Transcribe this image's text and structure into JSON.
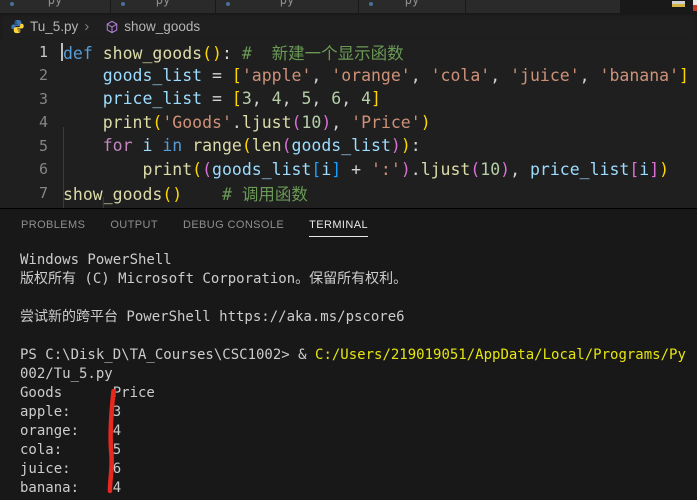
{
  "colors": {
    "editor_bg": "#1f1f1f",
    "panel_bg": "#181818",
    "tabstrip_bg": "#191919",
    "keyword_blue": "#569cd6",
    "keyword_purple": "#c586c0",
    "function_yellow": "#dcdcaa",
    "variable_blue": "#9cdcfe",
    "string_orange": "#ce9178",
    "number_green": "#b5cea8",
    "comment_green": "#6a9955",
    "bracket_gold": "#ffd700",
    "bracket_pink": "#da70d6",
    "bracket_blue": "#179fff",
    "terminal_fg": "#cccccc",
    "terminal_yellow": "#e5e510",
    "annotation_red": "#e8281e",
    "active_panel_tab": "#e7e7e7"
  },
  "top_tabs": [
    {
      "partial_label": "py"
    },
    {
      "partial_label": "py"
    },
    {
      "partial_label": "py"
    },
    {
      "partial_label": "py"
    },
    {
      "partial_label": ""
    }
  ],
  "breadcrumb": {
    "file": "Tu_5.py",
    "separator": "›",
    "symbol": "show_goods"
  },
  "editor": {
    "lines": [
      {
        "num": "1",
        "cursor": true,
        "tokens": [
          {
            "t": "def",
            "c": "kw"
          },
          {
            "t": " ",
            "c": "fg"
          },
          {
            "t": "show_goods",
            "c": "fn"
          },
          {
            "t": "(",
            "c": "b1"
          },
          {
            "t": ")",
            "c": "b1"
          },
          {
            "t": ":",
            "c": "fg"
          },
          {
            "t": " ",
            "c": "fg"
          },
          {
            "t": "#  新建一个显示函数",
            "c": "cm"
          }
        ]
      },
      {
        "num": "2",
        "tokens": [
          {
            "t": "    ",
            "c": "fg"
          },
          {
            "t": "goods_list",
            "c": "var"
          },
          {
            "t": " = ",
            "c": "fg"
          },
          {
            "t": "[",
            "c": "b1"
          },
          {
            "t": "'apple'",
            "c": "str"
          },
          {
            "t": ", ",
            "c": "fg"
          },
          {
            "t": "'orange'",
            "c": "str"
          },
          {
            "t": ", ",
            "c": "fg"
          },
          {
            "t": "'cola'",
            "c": "str"
          },
          {
            "t": ", ",
            "c": "fg"
          },
          {
            "t": "'juice'",
            "c": "str"
          },
          {
            "t": ", ",
            "c": "fg"
          },
          {
            "t": "'banana'",
            "c": "str"
          },
          {
            "t": "]",
            "c": "b1"
          }
        ]
      },
      {
        "num": "3",
        "tokens": [
          {
            "t": "    ",
            "c": "fg"
          },
          {
            "t": "price_list",
            "c": "var"
          },
          {
            "t": " = ",
            "c": "fg"
          },
          {
            "t": "[",
            "c": "b1"
          },
          {
            "t": "3",
            "c": "num"
          },
          {
            "t": ", ",
            "c": "fg"
          },
          {
            "t": "4",
            "c": "num"
          },
          {
            "t": ", ",
            "c": "fg"
          },
          {
            "t": "5",
            "c": "num"
          },
          {
            "t": ", ",
            "c": "fg"
          },
          {
            "t": "6",
            "c": "num"
          },
          {
            "t": ", ",
            "c": "fg"
          },
          {
            "t": "4",
            "c": "num"
          },
          {
            "t": "]",
            "c": "b1"
          }
        ]
      },
      {
        "num": "4",
        "tokens": [
          {
            "t": "    ",
            "c": "fg"
          },
          {
            "t": "print",
            "c": "fn"
          },
          {
            "t": "(",
            "c": "b1"
          },
          {
            "t": "'Goods'",
            "c": "str"
          },
          {
            "t": ".",
            "c": "fg"
          },
          {
            "t": "ljust",
            "c": "fn"
          },
          {
            "t": "(",
            "c": "b2"
          },
          {
            "t": "10",
            "c": "num"
          },
          {
            "t": ")",
            "c": "b2"
          },
          {
            "t": ", ",
            "c": "fg"
          },
          {
            "t": "'Price'",
            "c": "str"
          },
          {
            "t": ")",
            "c": "b1"
          }
        ]
      },
      {
        "num": "5",
        "tokens": [
          {
            "t": "    ",
            "c": "fg"
          },
          {
            "t": "for",
            "c": "kw2"
          },
          {
            "t": " ",
            "c": "fg"
          },
          {
            "t": "i",
            "c": "var"
          },
          {
            "t": " ",
            "c": "fg"
          },
          {
            "t": "in",
            "c": "kw"
          },
          {
            "t": " ",
            "c": "fg"
          },
          {
            "t": "range",
            "c": "fn"
          },
          {
            "t": "(",
            "c": "b1"
          },
          {
            "t": "len",
            "c": "fn"
          },
          {
            "t": "(",
            "c": "b2"
          },
          {
            "t": "goods_list",
            "c": "var"
          },
          {
            "t": ")",
            "c": "b2"
          },
          {
            "t": ")",
            "c": "b1"
          },
          {
            "t": ":",
            "c": "fg"
          }
        ]
      },
      {
        "num": "6",
        "tokens": [
          {
            "t": "        ",
            "c": "fg"
          },
          {
            "t": "print",
            "c": "fn"
          },
          {
            "t": "(",
            "c": "b1"
          },
          {
            "t": "(",
            "c": "b2"
          },
          {
            "t": "goods_list",
            "c": "var"
          },
          {
            "t": "[",
            "c": "b3"
          },
          {
            "t": "i",
            "c": "var"
          },
          {
            "t": "]",
            "c": "b3"
          },
          {
            "t": " + ",
            "c": "fg"
          },
          {
            "t": "':'",
            "c": "str"
          },
          {
            "t": ")",
            "c": "b2"
          },
          {
            "t": ".",
            "c": "fg"
          },
          {
            "t": "ljust",
            "c": "fn"
          },
          {
            "t": "(",
            "c": "b2"
          },
          {
            "t": "10",
            "c": "num"
          },
          {
            "t": ")",
            "c": "b2"
          },
          {
            "t": ", ",
            "c": "fg"
          },
          {
            "t": "price_list",
            "c": "var"
          },
          {
            "t": "[",
            "c": "b2"
          },
          {
            "t": "i",
            "c": "var"
          },
          {
            "t": "]",
            "c": "b2"
          },
          {
            "t": ")",
            "c": "b1"
          }
        ]
      },
      {
        "num": "7",
        "tokens": [
          {
            "t": "show_goods",
            "c": "fn"
          },
          {
            "t": "(",
            "c": "b1"
          },
          {
            "t": ")",
            "c": "b1"
          },
          {
            "t": "    ",
            "c": "fg"
          },
          {
            "t": "# 调用函数",
            "c": "cm"
          }
        ]
      }
    ]
  },
  "panel": {
    "tabs": [
      {
        "label": "PROBLEMS",
        "active": false
      },
      {
        "label": "OUTPUT",
        "active": false
      },
      {
        "label": "DEBUG CONSOLE",
        "active": false
      },
      {
        "label": "TERMINAL",
        "active": true
      }
    ]
  },
  "terminal": {
    "lines": [
      {
        "segments": [
          {
            "text": "Windows PowerShell",
            "color": "fg"
          }
        ]
      },
      {
        "segments": [
          {
            "text": "版权所有 (C) Microsoft Corporation。保留所有权利。",
            "color": "fg"
          }
        ]
      },
      {
        "segments": []
      },
      {
        "segments": [
          {
            "text": "尝试新的跨平台 PowerShell https://aka.ms/pscore6",
            "color": "fg"
          }
        ]
      },
      {
        "segments": []
      },
      {
        "segments": [
          {
            "text": "PS C:\\Disk_D\\TA_Courses\\CSC1002> & ",
            "color": "fg"
          },
          {
            "text": "C:/Users/219019051/AppData/Local/Programs/Py",
            "color": "yellow"
          }
        ]
      },
      {
        "segments": [
          {
            "text": "002/Tu_5.py",
            "color": "fg"
          }
        ]
      },
      {
        "segments": [
          {
            "text": "Goods      Price",
            "color": "fg"
          }
        ]
      },
      {
        "segments": [
          {
            "text": "apple:     3",
            "color": "fg"
          }
        ]
      },
      {
        "segments": [
          {
            "text": "orange:    4",
            "color": "fg"
          }
        ]
      },
      {
        "segments": [
          {
            "text": "cola:      5",
            "color": "fg"
          }
        ]
      },
      {
        "segments": [
          {
            "text": "juice:     6",
            "color": "fg"
          }
        ]
      },
      {
        "segments": [
          {
            "text": "banana:    4",
            "color": "fg"
          }
        ]
      }
    ]
  }
}
